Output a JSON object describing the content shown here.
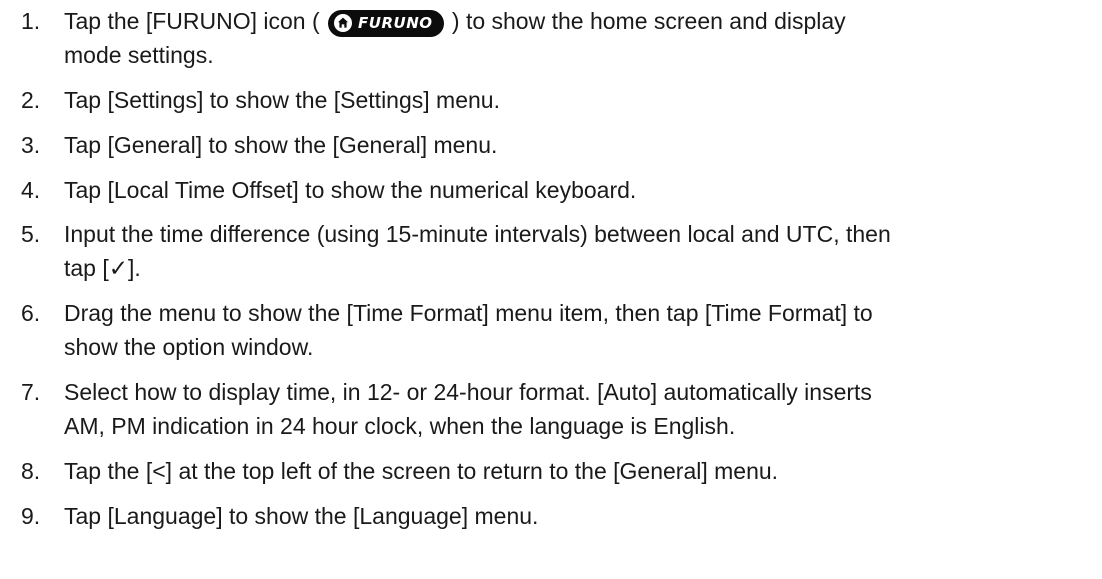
{
  "steps": [
    {
      "num": "1.",
      "lines": [
        {
          "before": "Tap the [FURUNO] icon (",
          "icon_name": "furuno-home-icon",
          "icon_label": "FURUNO",
          "after": ") to show the home screen and display"
        },
        {
          "text": "mode settings."
        }
      ]
    },
    {
      "num": "2.",
      "lines": [
        {
          "text": "Tap [Settings] to show the [Settings] menu."
        }
      ]
    },
    {
      "num": "3.",
      "lines": [
        {
          "text": "Tap [General] to show the [General] menu."
        }
      ]
    },
    {
      "num": "4.",
      "lines": [
        {
          "text": "Tap [Local Time Offset] to show the numerical keyboard."
        }
      ]
    },
    {
      "num": "5.",
      "lines": [
        {
          "text": "Input the time difference (using 15-minute intervals) between local and UTC, then"
        },
        {
          "text": "tap [✓]."
        }
      ]
    },
    {
      "num": "6.",
      "lines": [
        {
          "text": "Drag the menu to show the [Time Format] menu item, then tap [Time Format] to"
        },
        {
          "text": "show the option window."
        }
      ]
    },
    {
      "num": "7.",
      "lines": [
        {
          "text": "Select how to display time, in 12- or 24-hour format. [Auto] automatically inserts"
        },
        {
          "text": "AM, PM indication in 24 hour clock, when the language is English."
        }
      ]
    },
    {
      "num": "8.",
      "lines": [
        {
          "text": "Tap the [<] at the top left of the screen to return to the [General] menu."
        }
      ]
    },
    {
      "num": "9.",
      "lines": [
        {
          "text": "Tap [Language] to show the [Language] menu."
        }
      ]
    }
  ]
}
